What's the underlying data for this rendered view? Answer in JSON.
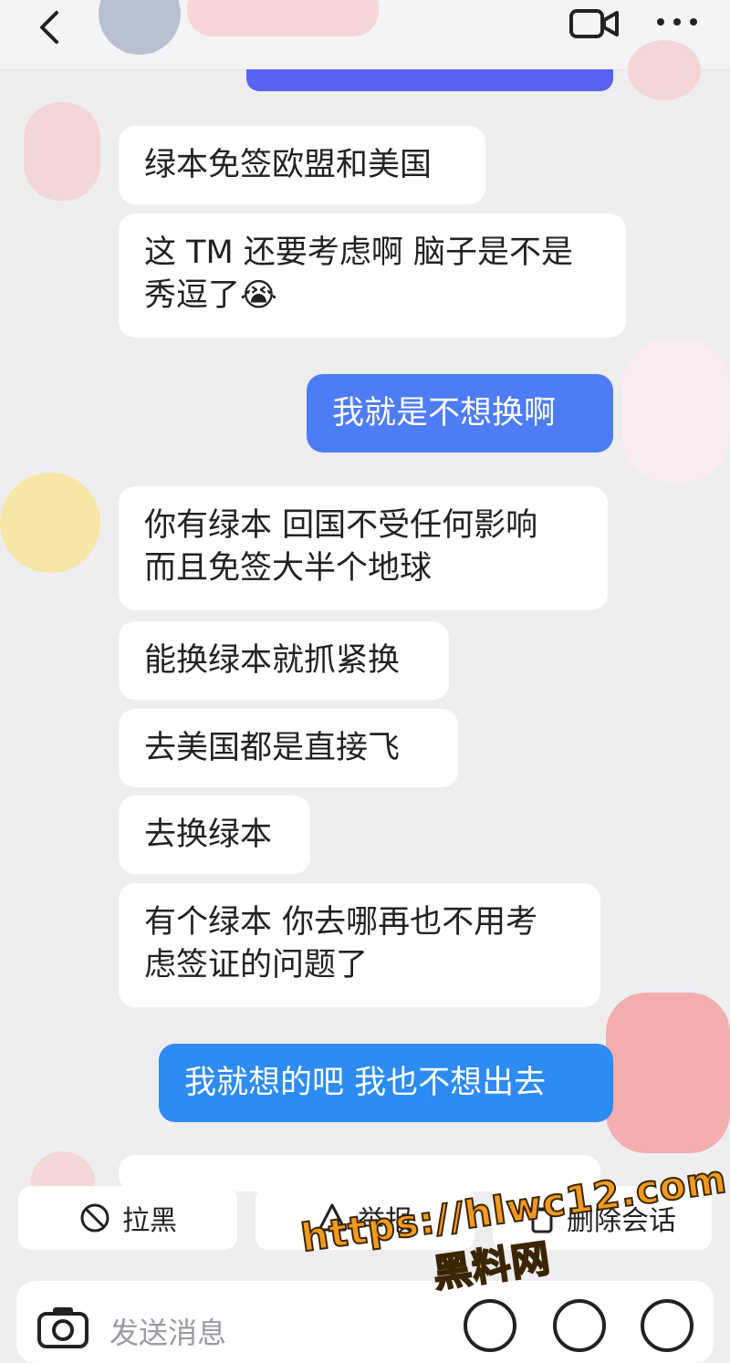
{
  "messages": [
    {
      "side": "left",
      "text": "绿本免签欧盟和美国"
    },
    {
      "side": "left",
      "text": "这 TM 还要考虑啊 脑子是不是\n秀逗了😭"
    },
    {
      "side": "right",
      "text": "我就是不想换啊"
    },
    {
      "side": "left",
      "text": "你有绿本 回国不受任何影响\n而且免签大半个地球"
    },
    {
      "side": "left",
      "text": "能换绿本就抓紧换"
    },
    {
      "side": "left",
      "text": "去美国都是直接飞"
    },
    {
      "side": "left",
      "text": "去换绿本"
    },
    {
      "side": "left",
      "text": "有个绿本 你去哪再也不用考\n虑签证的问题了"
    },
    {
      "side": "right",
      "text": "我就想的吧 我也不想出去"
    }
  ],
  "actions": {
    "block": "拉黑",
    "report": "举报",
    "delete": "删除会话"
  },
  "input": {
    "placeholder": "发送消息"
  },
  "watermark": {
    "line1": "https://hlwc12.com",
    "line2": "黑料网"
  },
  "colors": {
    "bg": "#eeeef1",
    "me_bubble": "#4d7cf6",
    "me_bubble_2": "#2d8cf3",
    "other_bubble": "#ffffff",
    "watermark": "#f39a1e"
  }
}
